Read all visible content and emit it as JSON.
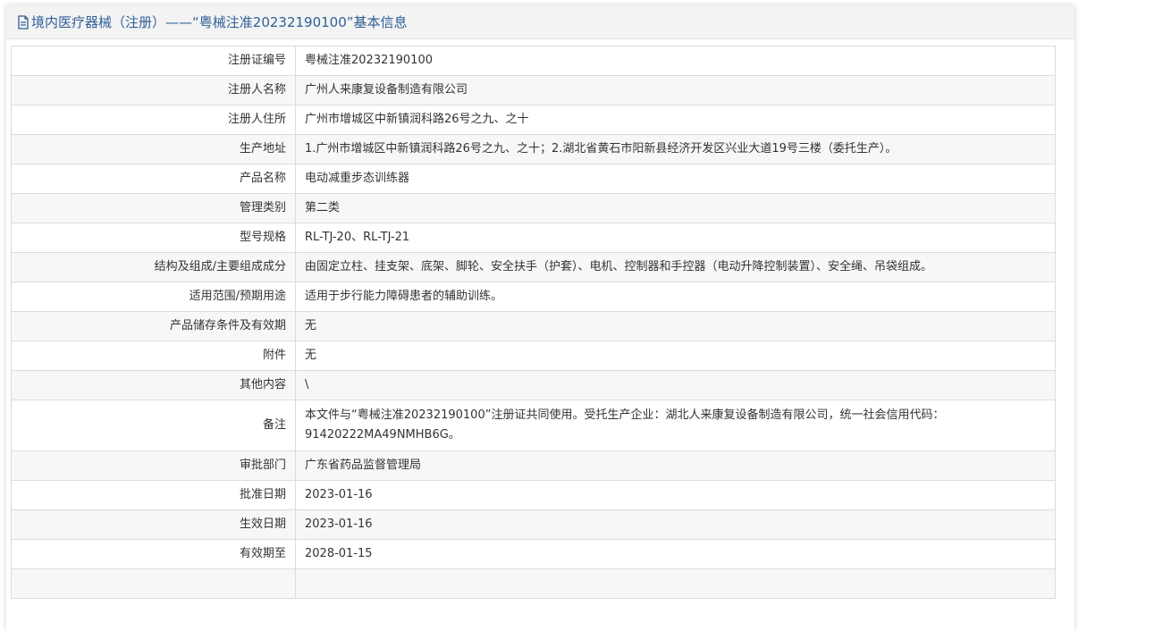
{
  "header": {
    "title": "境内医疗器械（注册）——“粤械注准20232190100”基本信息"
  },
  "rows": [
    {
      "label": "注册证编号",
      "value": "粤械注准20232190100"
    },
    {
      "label": "注册人名称",
      "value": "广州人来康复设备制造有限公司"
    },
    {
      "label": "注册人住所",
      "value": "广州市增城区中新镇润科路26号之九、之十"
    },
    {
      "label": "生产地址",
      "value": "1.广州市增城区中新镇润科路26号之九、之十；2.湖北省黄石市阳新县经济开发区兴业大道19号三楼（委托生产）。"
    },
    {
      "label": "产品名称",
      "value": "电动减重步态训练器"
    },
    {
      "label": "管理类别",
      "value": "第二类"
    },
    {
      "label": "型号规格",
      "value": "RL-TJ-20、RL-TJ-21"
    },
    {
      "label": "结构及组成/主要组成成分",
      "value": "由固定立柱、挂支架、底架、脚轮、安全扶手（护套）、电机、控制器和手控器（电动升降控制装置）、安全绳、吊袋组成。"
    },
    {
      "label": "适用范围/预期用途",
      "value": "适用于步行能力障碍患者的辅助训练。"
    },
    {
      "label": "产品储存条件及有效期",
      "value": "无"
    },
    {
      "label": "附件",
      "value": "无"
    },
    {
      "label": "其他内容",
      "value": "\\"
    },
    {
      "label": "备注",
      "value": "本文件与“粤械注准20232190100”注册证共同使用。受托生产企业：湖北人来康复设备制造有限公司，统一社会信用代码：91420222MA49NMHB6G。"
    },
    {
      "label": "审批部门",
      "value": "广东省药品监督管理局"
    },
    {
      "label": "批准日期",
      "value": "2023-01-16"
    },
    {
      "label": "生效日期",
      "value": "2023-01-16"
    },
    {
      "label": "有效期至",
      "value": "2028-01-15"
    },
    {
      "label": "",
      "value": ""
    }
  ],
  "colors": {
    "header_text": "#2f5f98",
    "header_bg": "#f3f3f3",
    "row_alt_bg": "#f7f7f7",
    "border": "#dcdcdc"
  },
  "icons": {
    "header_icon": "document-icon"
  }
}
